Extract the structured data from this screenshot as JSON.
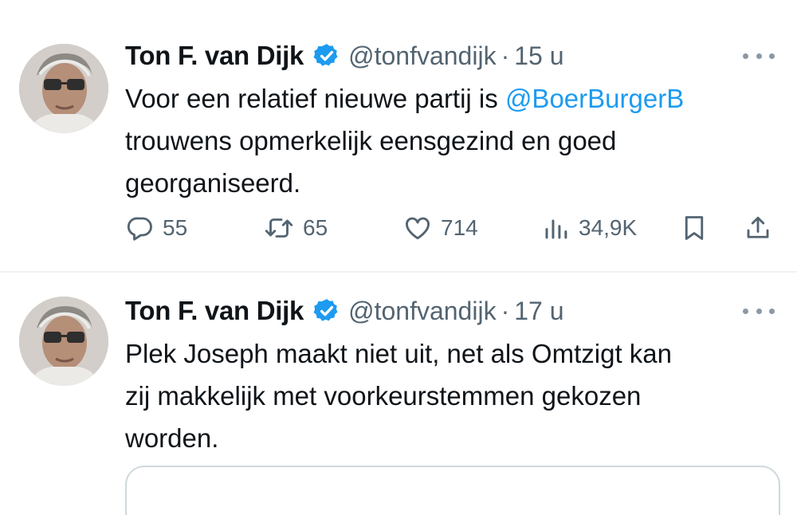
{
  "tweets": [
    {
      "author": {
        "name": "Ton F. van Dijk",
        "handle": "@tonfvandijk",
        "verified": true
      },
      "separator": "·",
      "time": "15 u",
      "text": {
        "line1_before": "Voor een relatief nieuwe partij is ",
        "mention": "@BoerBurgerB",
        "line2": "trouwens opmerkelijk eensgezind en goed",
        "line3": "georganiseerd."
      },
      "actions": {
        "replies": "55",
        "retweets": "65",
        "likes": "714",
        "views": "34,9K"
      }
    },
    {
      "author": {
        "name": "Ton F. van Dijk",
        "handle": "@tonfvandijk",
        "verified": true
      },
      "separator": "·",
      "time": "17 u",
      "text": {
        "line1": "Plek Joseph maakt niet uit, net als Omtzigt kan",
        "line2": "zij makkelijk met voorkeurstemmen gekozen",
        "line3": "worden."
      }
    }
  ],
  "icons": {
    "more": "more-horizontal-icon",
    "verified": "verified-badge-icon",
    "reply": "reply-icon",
    "retweet": "retweet-icon",
    "like": "heart-icon",
    "views": "views-icon",
    "bookmark": "bookmark-icon",
    "share": "share-icon"
  },
  "colors": {
    "accent": "#1d9bf0",
    "text": "#0f1419",
    "secondary": "#536471",
    "divider": "#eff3f4"
  }
}
